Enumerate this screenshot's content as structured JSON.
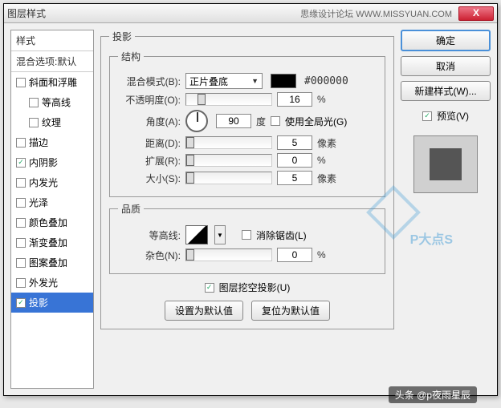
{
  "titlebar": {
    "title": "图层样式",
    "forum": "思缘设计论坛  WWW.MISSYUAN.COM",
    "close": "X"
  },
  "styles": {
    "header": "样式",
    "sub": "混合选项:默认",
    "items": [
      {
        "label": "斜面和浮雕",
        "checked": false,
        "indent": false
      },
      {
        "label": "等高线",
        "checked": false,
        "indent": true
      },
      {
        "label": "纹理",
        "checked": false,
        "indent": true
      },
      {
        "label": "描边",
        "checked": false,
        "indent": false
      },
      {
        "label": "内阴影",
        "checked": true,
        "indent": false
      },
      {
        "label": "内发光",
        "checked": false,
        "indent": false
      },
      {
        "label": "光泽",
        "checked": false,
        "indent": false
      },
      {
        "label": "颜色叠加",
        "checked": false,
        "indent": false
      },
      {
        "label": "渐变叠加",
        "checked": false,
        "indent": false
      },
      {
        "label": "图案叠加",
        "checked": false,
        "indent": false
      },
      {
        "label": "外发光",
        "checked": false,
        "indent": false
      },
      {
        "label": "投影",
        "checked": true,
        "indent": false,
        "selected": true
      }
    ]
  },
  "shadow": {
    "group": "投影",
    "structure": "结构",
    "blend_label": "混合模式(B):",
    "blend_value": "正片叠底",
    "color_hex": "#000000",
    "opacity_label": "不透明度(O):",
    "opacity_value": "16",
    "percent": "%",
    "angle_label": "角度(A):",
    "angle_value": "90",
    "degree": "度",
    "global_label": "使用全局光(G)",
    "distance_label": "距离(D):",
    "distance_value": "5",
    "px": "像素",
    "spread_label": "扩展(R):",
    "spread_value": "0",
    "size_label": "大小(S):",
    "size_value": "5",
    "quality": "品质",
    "contour_label": "等高线:",
    "aa_label": "消除锯齿(L)",
    "noise_label": "杂色(N):",
    "noise_value": "0",
    "knockout_label": "图层挖空投影(U)",
    "reset_default": "设置为默认值",
    "restore_default": "复位为默认值"
  },
  "right": {
    "ok": "确定",
    "cancel": "取消",
    "newstyle": "新建样式(W)...",
    "preview_label": "预览(V)"
  },
  "footer": "头条 @p夜雨星辰",
  "watermark": "P大点S"
}
